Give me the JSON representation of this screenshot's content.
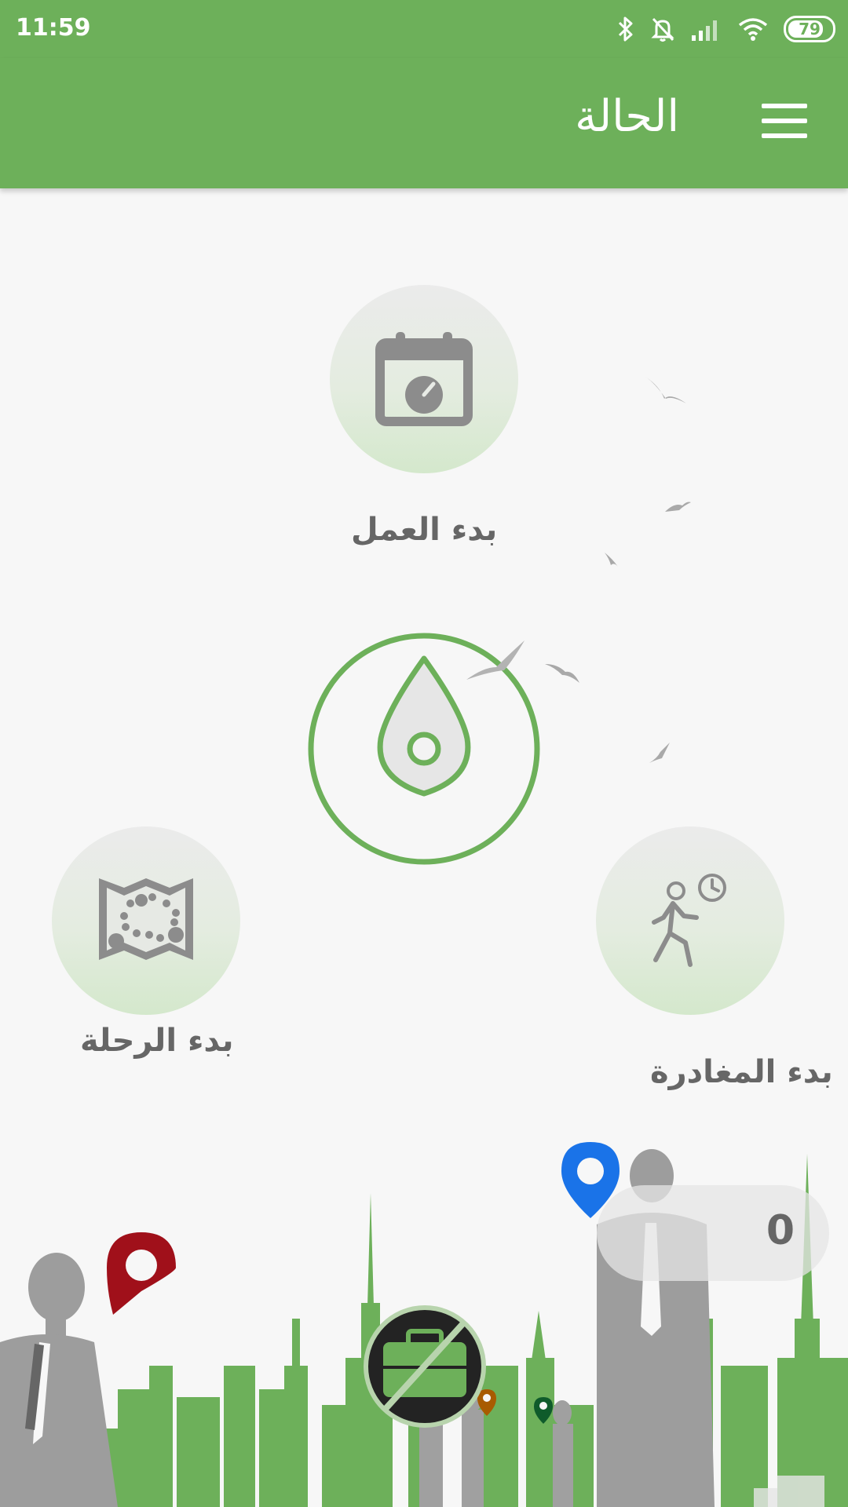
{
  "status_bar": {
    "time": "11:59",
    "battery": "79",
    "icons": [
      "bluetooth-icon",
      "muted-bell-icon",
      "signal-icon",
      "wifi-icon",
      "battery-icon"
    ]
  },
  "app_bar": {
    "title": "الحالة",
    "menu_icon": "hamburger-menu-icon"
  },
  "actions": {
    "start_work": {
      "label": "بدء العمل",
      "icon": "calendar-clock-icon"
    },
    "start_trip": {
      "label": "بدء الرحلة",
      "icon": "map-route-icon"
    },
    "start_departure": {
      "label": "بدء المغادرة",
      "icon": "walking-person-clock-icon"
    },
    "center": {
      "icon": "location-drop-icon"
    }
  },
  "counter": {
    "value": "0"
  },
  "colors": {
    "primary": "#6db05a",
    "button_gray": "#8c8c8c",
    "label_gray": "#666666",
    "background": "#f7f7f7"
  }
}
